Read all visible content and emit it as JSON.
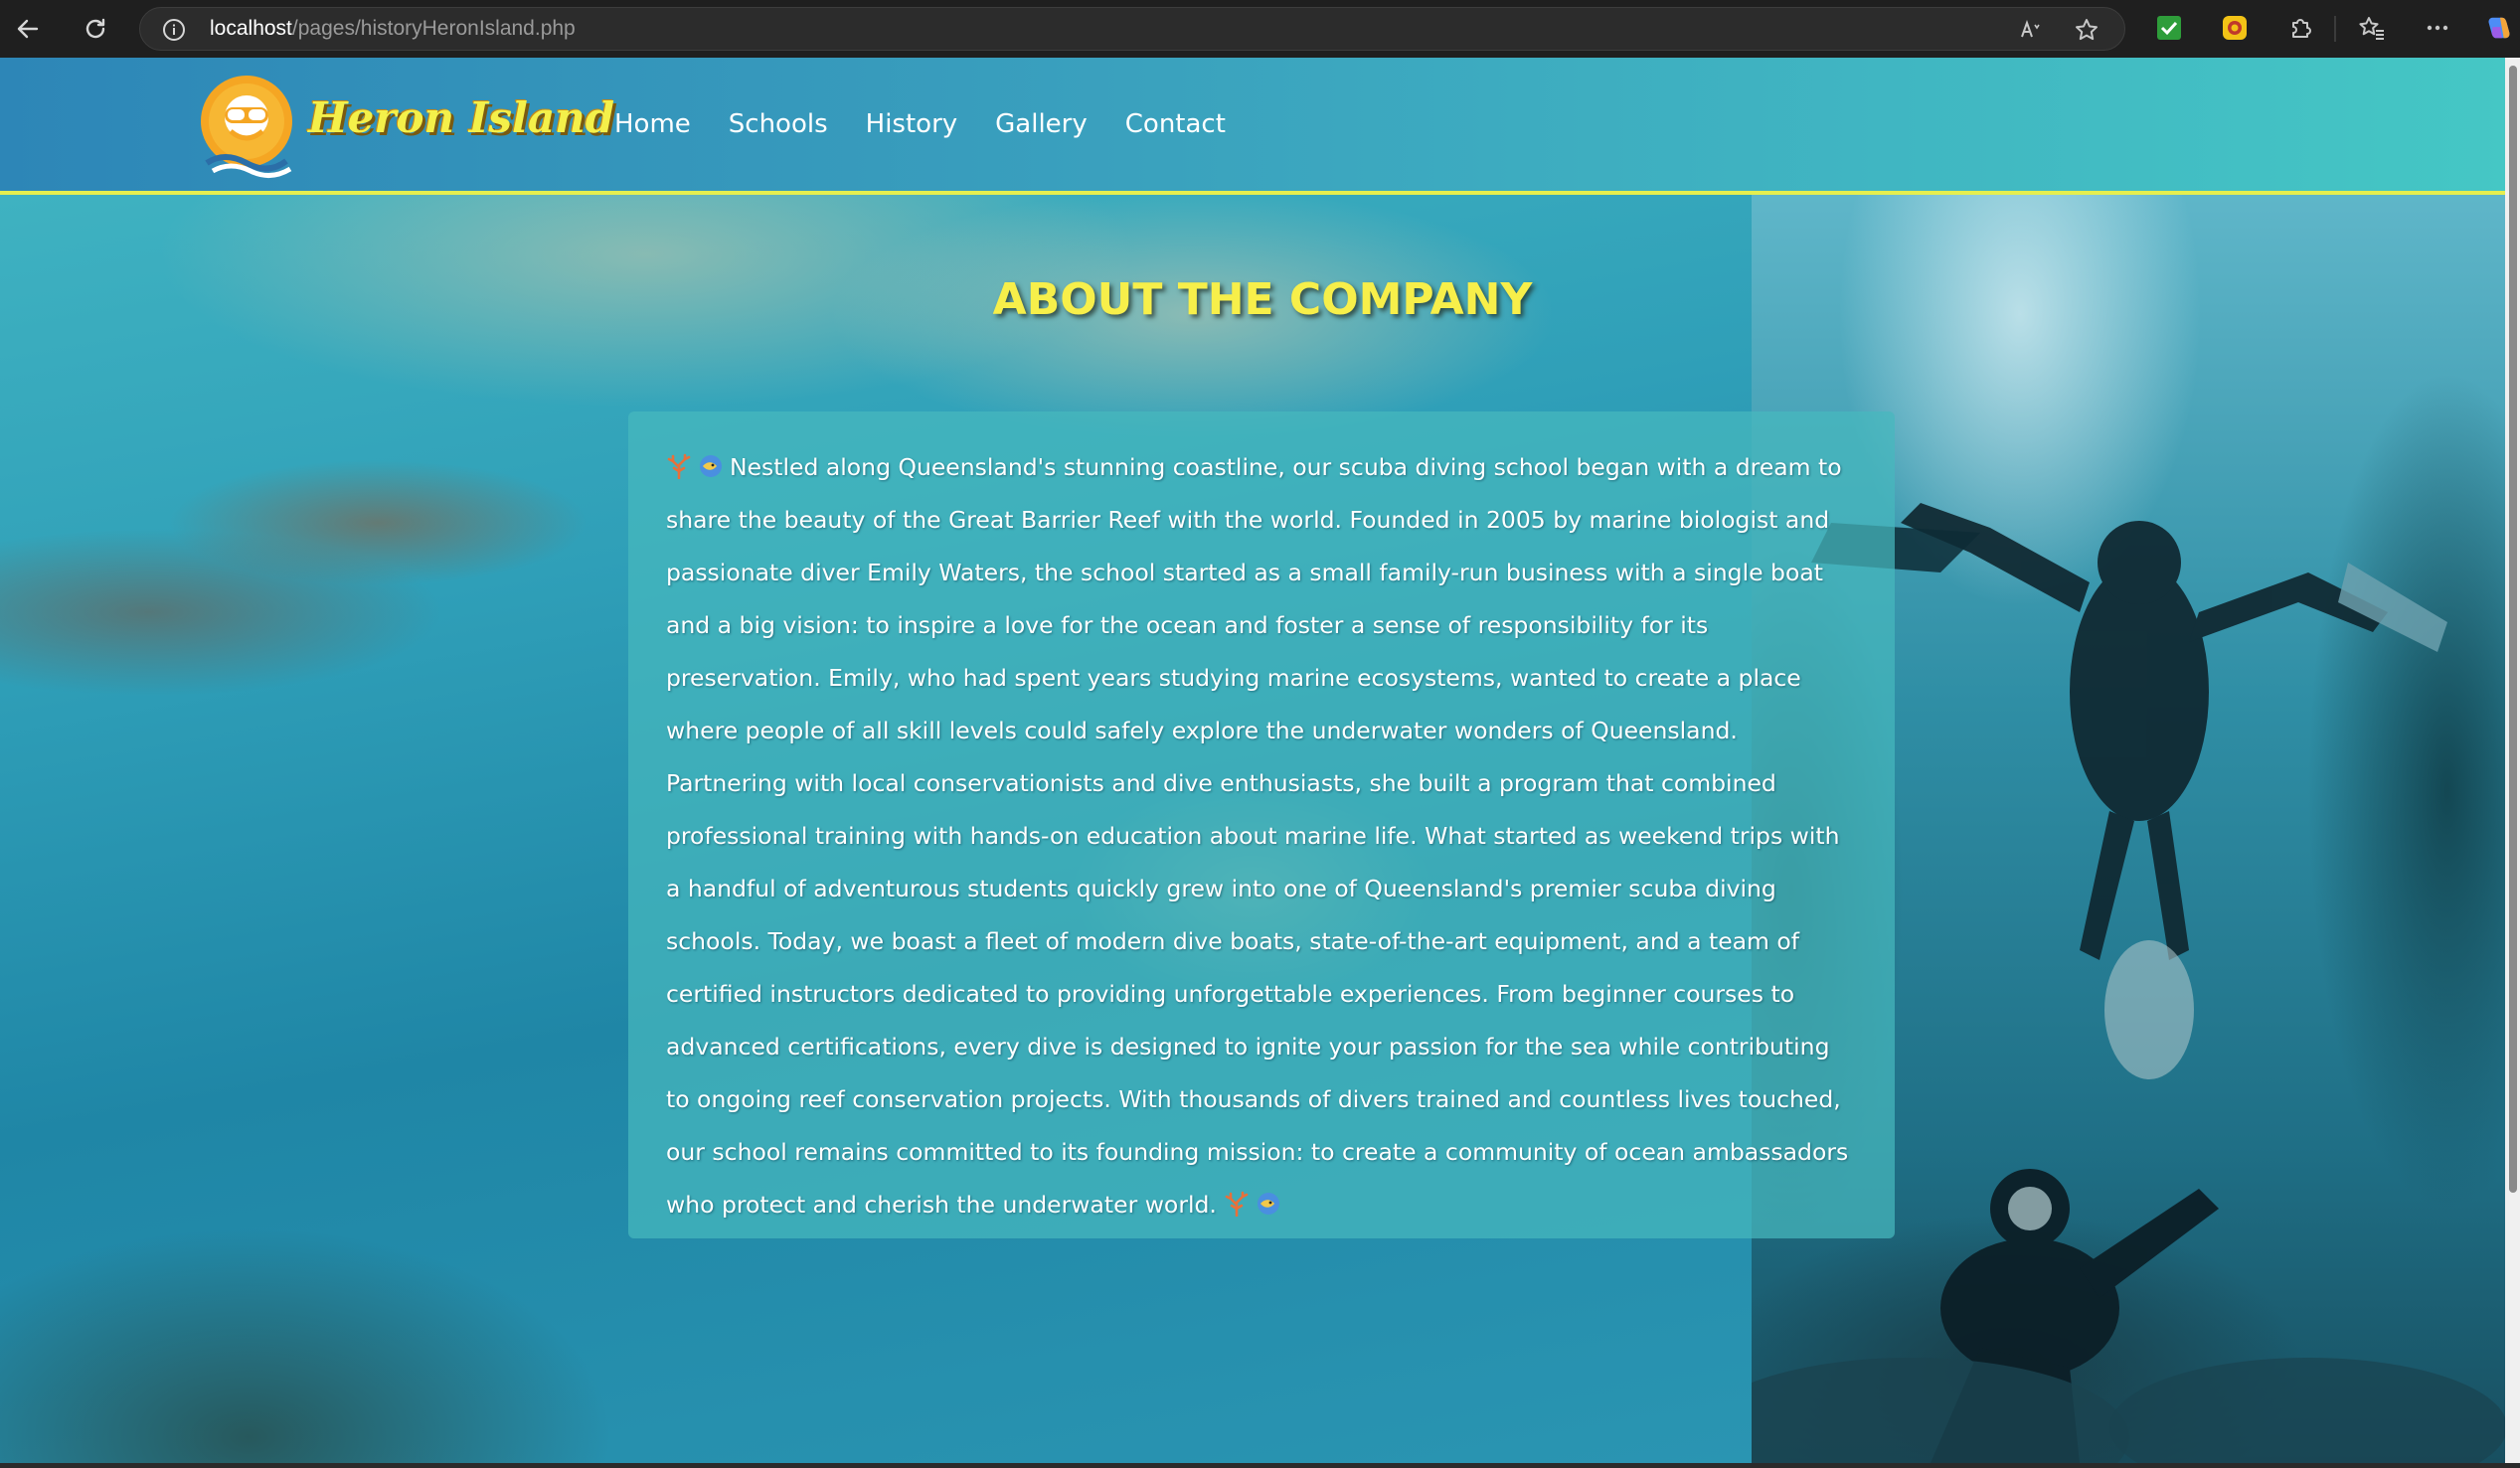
{
  "browser": {
    "url_host": "localhost",
    "url_path": "/pages/historyHeronIsland.php"
  },
  "site": {
    "logo_text": "Heron Island",
    "nav": [
      "Home",
      "Schools",
      "History",
      "Gallery",
      "Contact"
    ]
  },
  "content": {
    "title": "ABOUT THE COMPANY",
    "paragraph": "Nestled along Queensland's stunning coastline, our scuba diving school began with a dream to share the beauty of the Great Barrier Reef with the world. Founded in 2005 by marine biologist and passionate diver Emily Waters, the school started as a small family-run business with a single boat and a big vision: to inspire a love for the ocean and foster a sense of responsibility for its preservation. Emily, who had spent years studying marine ecosystems, wanted to create a place where people of all skill levels could safely explore the underwater wonders of Queensland. Partnering with local conservationists and dive enthusiasts, she built a program that combined professional training with hands-on education about marine life. What started as weekend trips with a handful of adventurous students quickly grew into one of Queensland's premier scuba diving schools. Today, we boast a fleet of modern dive boats, state-of-the-art equipment, and a team of certified instructors dedicated to providing unforgettable experiences. From beginner courses to advanced certifications, every dive is designed to ignite your passion for the sea while contributing to ongoing reef conservation projects. With thousands of divers trained and countless lives touched, our school remains committed to its founding mission: to create a community of ocean ambassadors who protect and cherish the underwater world.",
    "leading_icons": [
      "coral-icon",
      "fish-icon"
    ],
    "trailing_icons": [
      "coral-icon",
      "fish-icon"
    ]
  },
  "colors": {
    "title": "#f7ef4a",
    "logo_text": "#f4f04a",
    "header_border": "#e5ef4f",
    "card_bg": "rgba(70,185,190,0.72)"
  }
}
